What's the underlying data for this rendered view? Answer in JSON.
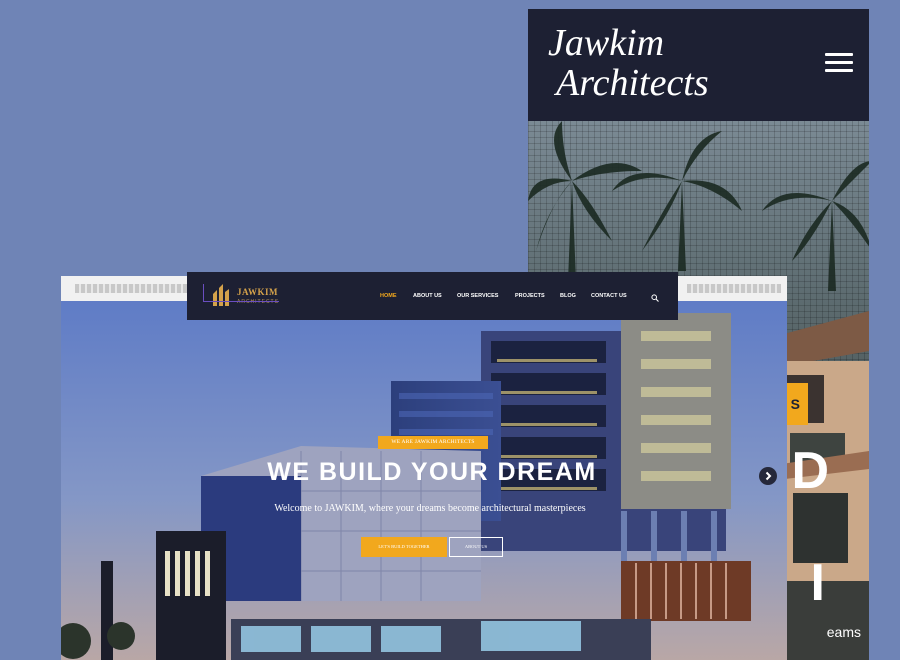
{
  "mobile": {
    "logo_line1": "Jawkim",
    "logo_line2": "Architects",
    "menu_icon": "hamburger-menu-icon",
    "badge_text": "S",
    "hero_big_text_1": "D",
    "hero_big_text_2": "I",
    "hero_sub_text": "eams"
  },
  "desktop": {
    "logo_text": "JAWKIM",
    "logo_subtext": "ARCHITECTS",
    "menu": [
      {
        "label": "HOME",
        "active": true
      },
      {
        "label": "ABOUT US",
        "active": false
      },
      {
        "label": "OUR SERVICES",
        "active": false
      },
      {
        "label": "PROJECTS",
        "active": false
      },
      {
        "label": "BLOG",
        "active": false
      },
      {
        "label": "CONTACT US",
        "active": false
      }
    ],
    "search_icon": "search-icon",
    "hero": {
      "tagline": "WE ARE JAWKIM ARCHITECTS",
      "headline": "WE BUILD YOUR DREAM",
      "subheadline": "Welcome to JAWKIM, where your dreams become architectural masterpieces",
      "primary_button": "LET'S BUILD TOGETHER",
      "secondary_button": "ABOUT US"
    },
    "next_icon": "chevron-right-icon"
  },
  "colors": {
    "page_background": "#6f84b6",
    "navy": "#1d2033",
    "accent": "#f2a81d",
    "logo_gold": "#d4a24b"
  }
}
